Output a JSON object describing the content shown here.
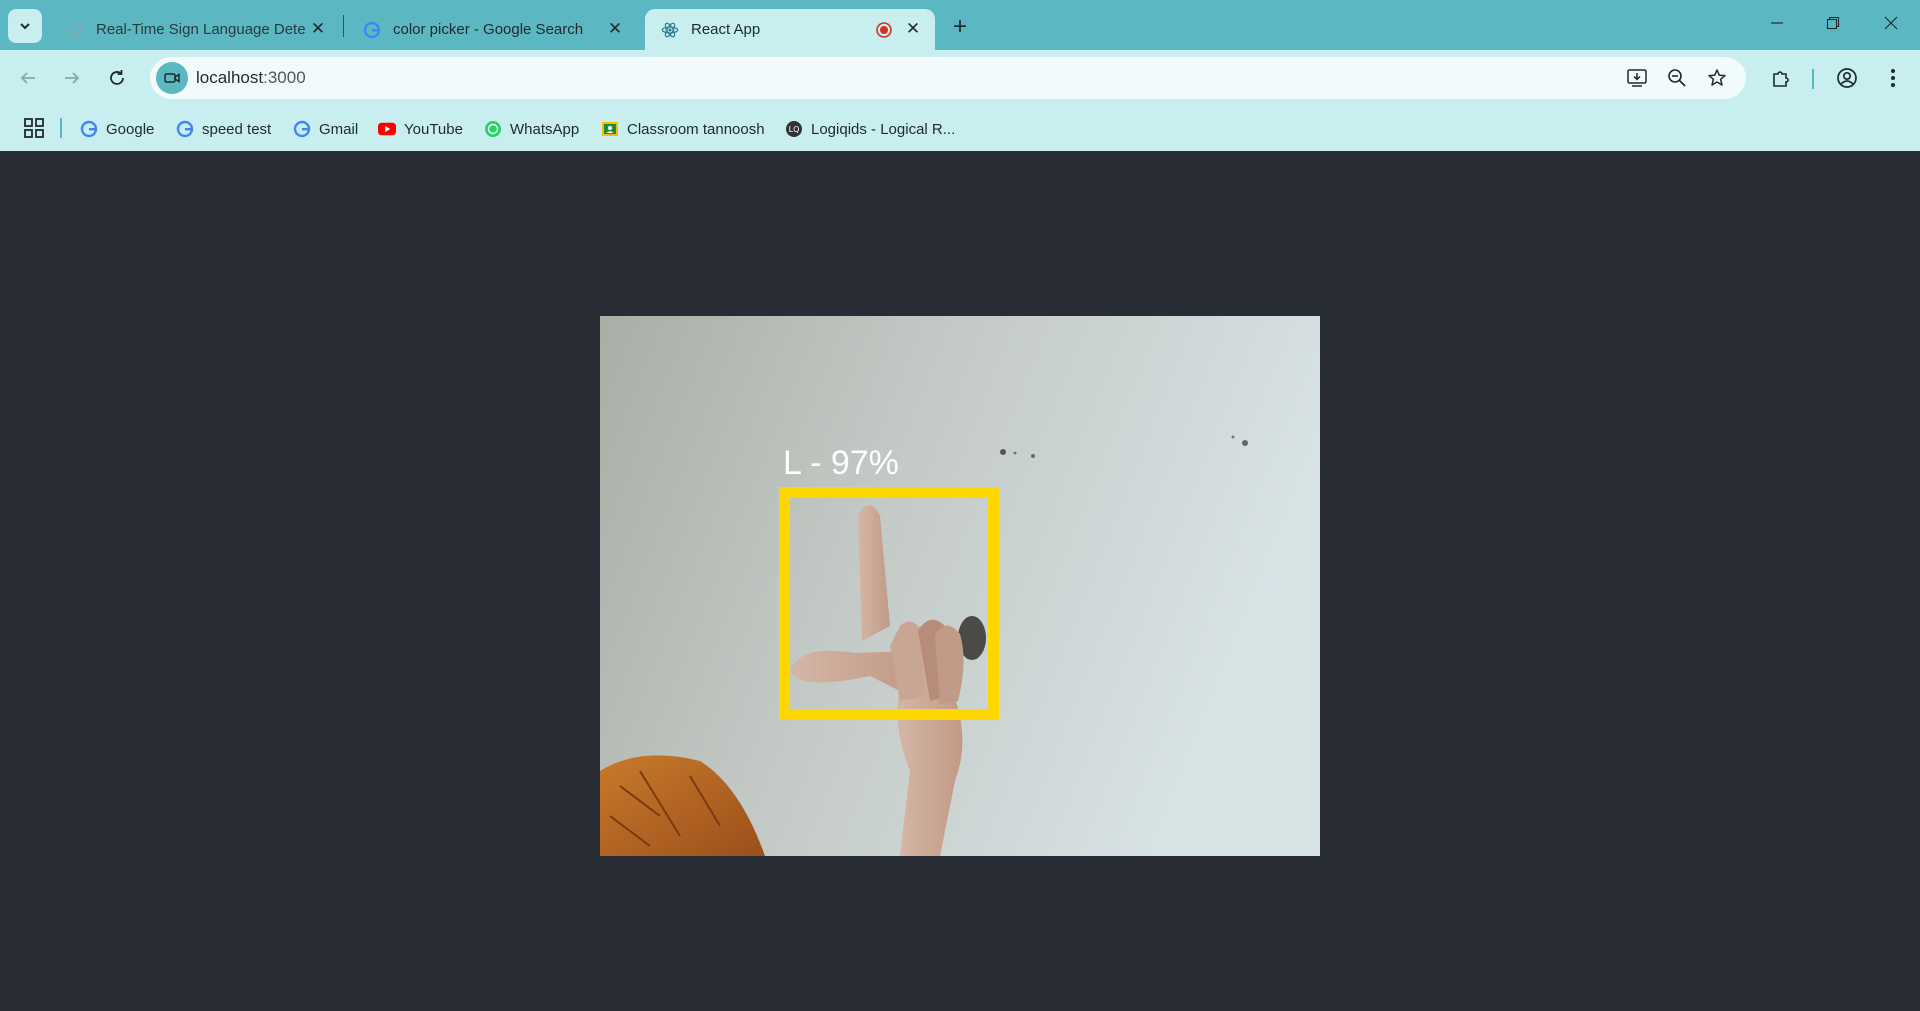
{
  "browser": {
    "tabs": [
      {
        "title": "Real-Time Sign Language Detec",
        "active": false
      },
      {
        "title": "color picker - Google Search",
        "active": false
      },
      {
        "title": "React App",
        "active": true
      }
    ],
    "url_host": "localhost",
    "url_port": ":3000",
    "bookmarks": [
      {
        "label": "Google",
        "icon": "google-icon"
      },
      {
        "label": "speed test",
        "icon": "google-icon"
      },
      {
        "label": "Gmail",
        "icon": "google-icon"
      },
      {
        "label": "YouTube",
        "icon": "youtube-icon"
      },
      {
        "label": "WhatsApp",
        "icon": "whatsapp-icon"
      },
      {
        "label": "Classroom tannoosh",
        "icon": "classroom-icon"
      },
      {
        "label": "Logiqids - Logical R...",
        "icon": "logiqids-icon"
      }
    ]
  },
  "app": {
    "detection_label": "L - 97%",
    "box_color": "#ffd700",
    "background": "#282c34"
  }
}
